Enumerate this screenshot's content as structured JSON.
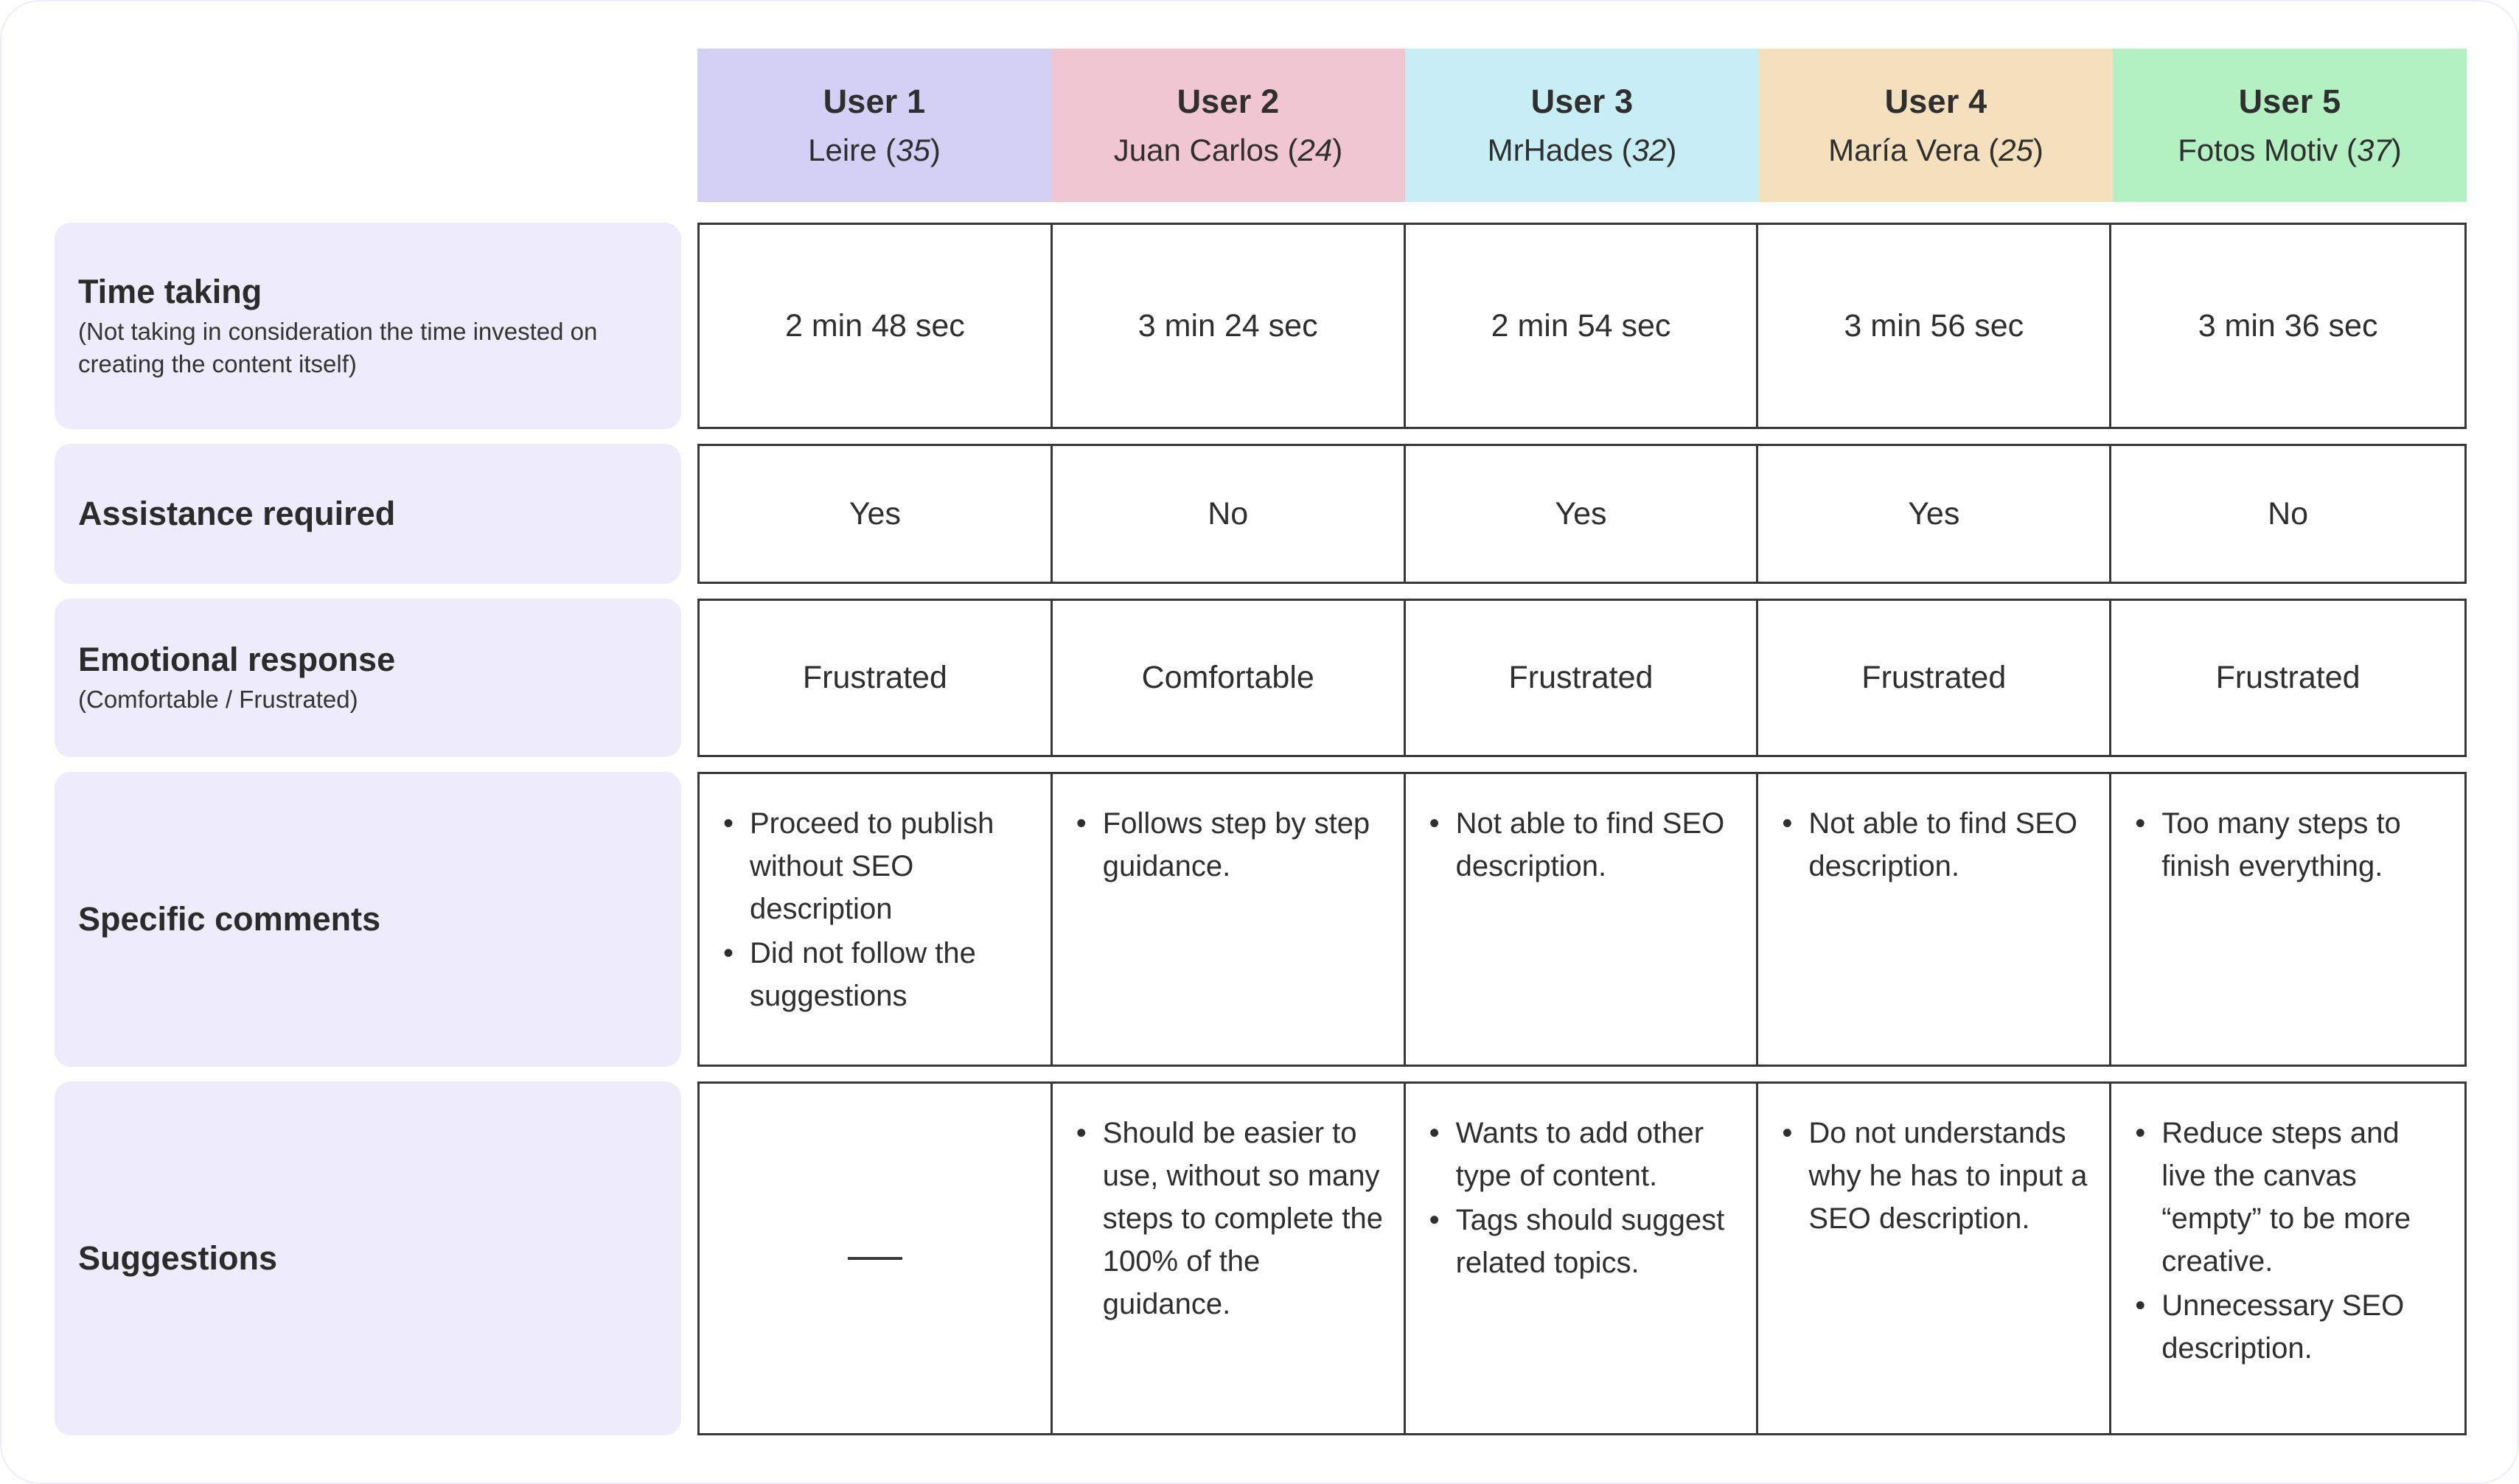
{
  "colors": {
    "user1": "#d4cff5",
    "user2": "#f0c6d3",
    "user3": "#c7eef5",
    "user4": "#f5e0bd",
    "user5": "#b3f0c2",
    "label_bg": "#eeebfa",
    "grid_border": "#383838",
    "text": "#2f2f2f"
  },
  "header": {
    "users": [
      {
        "title": "User 1",
        "name": "Leire",
        "age": "35",
        "color": "#d4cff5"
      },
      {
        "title": "User 2",
        "name": "Juan Carlos",
        "age": "24",
        "color": "#f0c6d3"
      },
      {
        "title": "User 3",
        "name": "MrHades",
        "age": "32",
        "color": "#c7eef5"
      },
      {
        "title": "User 4",
        "name": "María Vera",
        "age": "25",
        "color": "#f5e0bd"
      },
      {
        "title": "User 5",
        "name": "Fotos Motiv",
        "age": "37",
        "color": "#b3f0c2"
      }
    ]
  },
  "rows": [
    {
      "label": "Time taking",
      "sublabel": "(Not taking in consideration the time invested on creating the content itself)",
      "cells": [
        {
          "text": "2 min 48 sec"
        },
        {
          "text": "3 min 24 sec"
        },
        {
          "text": "2 min 54 sec"
        },
        {
          "text": "3 min 56 sec"
        },
        {
          "text": "3 min 36 sec"
        }
      ]
    },
    {
      "label": "Assistance required",
      "sublabel": "",
      "cells": [
        {
          "text": "Yes"
        },
        {
          "text": "No"
        },
        {
          "text": "Yes"
        },
        {
          "text": "Yes"
        },
        {
          "text": "No"
        }
      ]
    },
    {
      "label": "Emotional response",
      "sublabel": "(Comfortable / Frustrated)",
      "cells": [
        {
          "text": "Frustrated"
        },
        {
          "text": "Comfortable"
        },
        {
          "text": "Frustrated"
        },
        {
          "text": "Frustrated"
        },
        {
          "text": "Frustrated"
        }
      ]
    },
    {
      "label": "Specific comments",
      "sublabel": "",
      "cells": [
        {
          "bullets": [
            "Proceed to publish without SEO description",
            "Did not follow the suggestions"
          ]
        },
        {
          "bullets": [
            "Follows step by step guidance."
          ]
        },
        {
          "bullets": [
            "Not able to find SEO description."
          ]
        },
        {
          "bullets": [
            "Not able to find SEO description."
          ]
        },
        {
          "bullets": [
            "Too many steps to finish everything."
          ]
        }
      ]
    },
    {
      "label": "Suggestions",
      "sublabel": "",
      "cells": [
        {
          "dash": true
        },
        {
          "bullets": [
            "Should be easier to use, without so many steps to complete the 100% of the guidance."
          ]
        },
        {
          "bullets": [
            "Wants to add other type of content.",
            "Tags should suggest related topics."
          ]
        },
        {
          "bullets": [
            "Do not understands why he has to input a SEO description."
          ]
        },
        {
          "bullets": [
            "Reduce steps and live the canvas “empty” to be more creative.",
            "Unnecessary SEO description."
          ]
        }
      ]
    }
  ]
}
